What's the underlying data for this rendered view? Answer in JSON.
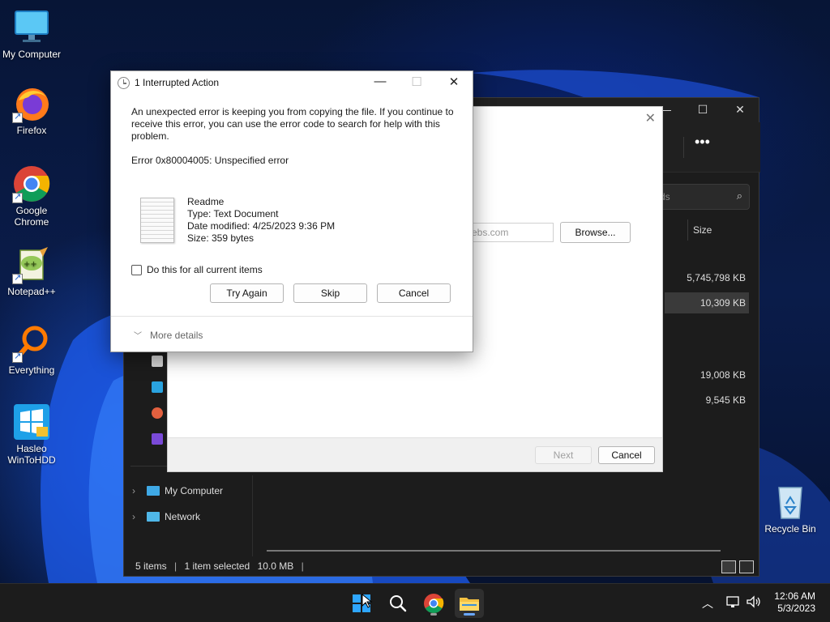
{
  "desktop": {
    "icons": [
      {
        "label": "My Computer",
        "icon": "monitor-icon"
      },
      {
        "label": "Firefox",
        "icon": "firefox-icon"
      },
      {
        "label": "Google Chrome",
        "icon": "chrome-icon"
      },
      {
        "label": "Notepad++",
        "icon": "notepadpp-icon"
      },
      {
        "label": "Everything",
        "icon": "everything-icon"
      },
      {
        "label": "Hasleo WinToHDD",
        "icon": "wintohdd-icon"
      },
      {
        "label": "Recycle Bin",
        "icon": "recycle-bin-icon"
      }
    ]
  },
  "explorer": {
    "search_placeholder": "ds",
    "column_size": "Size",
    "sizes": [
      "5,745,798 KB",
      "10,309 KB",
      "19,008 KB",
      "9,545 KB"
    ],
    "nav": [
      {
        "label": "My Computer",
        "icon": "monitor-icon"
      },
      {
        "label": "Network",
        "icon": "network-icon"
      }
    ],
    "status": {
      "items": "5 items",
      "selected": "1 item selected",
      "size": "10.0 MB"
    }
  },
  "wizard": {
    "dest_value": "ebs.com",
    "browse_label": "Browse...",
    "next_label": "Next",
    "cancel_label": "Cancel"
  },
  "dialog": {
    "title": "1 Interrupted Action",
    "message": "An unexpected error is keeping you from copying the file. If you continue to receive this error, you can use the error code to search for help with this problem.",
    "error": "Error 0x80004005: Unspecified error",
    "file": {
      "name": "Readme",
      "type": "Type: Text Document",
      "modified": "Date modified: 4/25/2023 9:36 PM",
      "size": "Size: 359 bytes"
    },
    "checkbox_label": "Do this for all current items",
    "checkbox_checked": false,
    "buttons": {
      "try_again": "Try Again",
      "skip": "Skip",
      "cancel": "Cancel"
    },
    "more_details": "More details"
  },
  "taskbar": {
    "apps": [
      "start-icon",
      "search-icon",
      "chrome-icon",
      "file-explorer-icon"
    ],
    "clock": {
      "time": "12:06 AM",
      "date": "5/3/2023"
    }
  }
}
